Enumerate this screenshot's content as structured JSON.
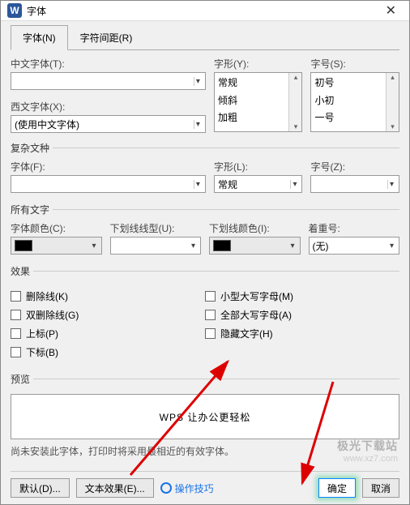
{
  "window": {
    "title": "字体"
  },
  "tabs": {
    "font": "字体(N)",
    "spacing": "字符间距(R)"
  },
  "labels": {
    "cnfont": "中文字体(T):",
    "style": "字形(Y):",
    "size": "字号(S):",
    "wfont": "西文字体(X):",
    "wfont_val": "(使用中文字体)",
    "complex_group": "复杂文种",
    "fontF": "字体(F):",
    "styleL": "字形(L):",
    "styleL_val": "常规",
    "sizeZ": "字号(Z):",
    "alltext_group": "所有文字",
    "fontcolor": "字体颜色(C):",
    "underline": "下划线线型(U):",
    "ulcolor": "下划线颜色(I):",
    "emphasis": "着重号:",
    "emphasis_val": "(无)",
    "effects_group": "效果",
    "preview_group": "预览",
    "preview_text": "WPS 让办公更轻松",
    "hint": "尚未安装此字体，打印时将采用最相近的有效字体。"
  },
  "style_options": [
    "常规",
    "倾斜",
    "加粗"
  ],
  "size_options": [
    "初号",
    "小初",
    "一号"
  ],
  "effects": {
    "strike": "删除线(K)",
    "dblstrike": "双删除线(G)",
    "sup": "上标(P)",
    "sub": "下标(B)",
    "smallcaps": "小型大写字母(M)",
    "allcaps": "全部大写字母(A)",
    "hidden": "隐藏文字(H)"
  },
  "buttons": {
    "default": "默认(D)...",
    "texteffect": "文本效果(E)...",
    "tips": "操作技巧",
    "ok": "确定",
    "cancel": "取消"
  },
  "watermark": {
    "big": "极光下载站",
    "small": "www.xz7.com"
  }
}
